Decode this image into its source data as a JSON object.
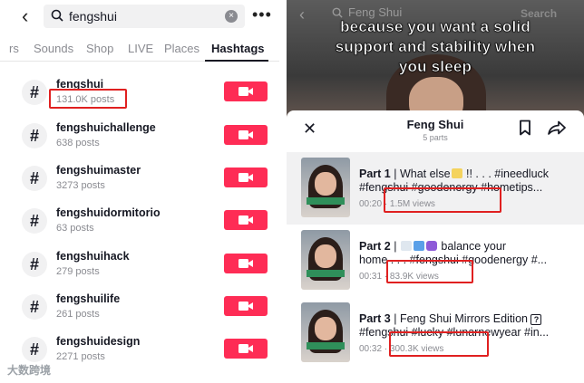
{
  "left": {
    "search": {
      "query": "fengshui",
      "clear": "×"
    },
    "more": "•••",
    "tabs": [
      "rs",
      "Sounds",
      "Shop",
      "LIVE",
      "Places",
      "Hashtags"
    ],
    "hashtags": [
      {
        "name": "fengshui",
        "posts": "131.0K posts"
      },
      {
        "name": "fengshuichallenge",
        "posts": "638 posts"
      },
      {
        "name": "fengshuimaster",
        "posts": "3273 posts"
      },
      {
        "name": "fengshuidormitorio",
        "posts": "63 posts"
      },
      {
        "name": "fengshuihack",
        "posts": "279 posts"
      },
      {
        "name": "fengshuilife",
        "posts": "261 posts"
      },
      {
        "name": "fengshuidesign",
        "posts": "2271 posts"
      }
    ],
    "hash_symbol": "#",
    "watermark": "大数跨境"
  },
  "right": {
    "top": {
      "search": "Feng Shui",
      "search_btn": "Search"
    },
    "caption": [
      "because you want a solid",
      "support and stability when",
      "you sleep"
    ],
    "sheet": {
      "title": "Feng Shui",
      "parts": "5 parts",
      "items": [
        {
          "part": "Part 1",
          "line1": " | What else",
          "line1b": " !! . . . #ineedluck",
          "line2": "#fengshui #goodenergy #hometips...",
          "time": "00:20",
          "views": "· 1.5M views"
        },
        {
          "part": "Part 2",
          "line1": " | ",
          "line1b": " balance your",
          "line2": "home . . . #fengshui #goodenergy #...",
          "time": "00:31",
          "views": "· 83.9K views"
        },
        {
          "part": "Part 3",
          "line1": " | Feng Shui Mirrors Edition ",
          "line1b": "?",
          "line2": "#fengshui #lucky #lunarnewyear #in...",
          "time": "00:32",
          "views": "· 300.3K views"
        }
      ]
    }
  },
  "colors": {
    "accent": "#fe2c55",
    "highlight": "#e02020"
  }
}
